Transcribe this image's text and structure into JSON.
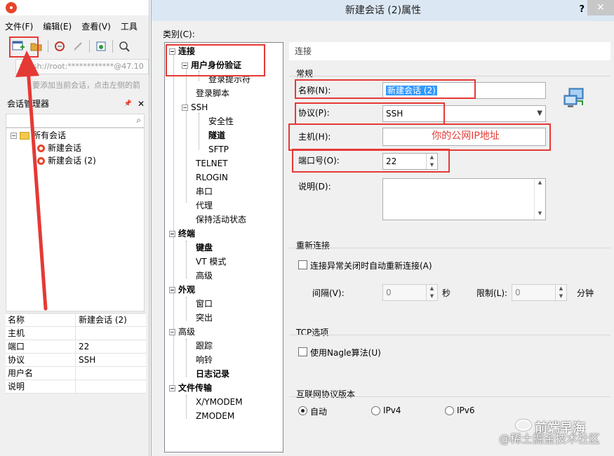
{
  "left": {
    "menu": [
      "文件(F)",
      "编辑(E)",
      "查看(V)",
      "工具"
    ],
    "address": "ssh://root:************@47.10",
    "hint": "要添加当前会话，点击左侧的箭",
    "session_manager_title": "会话管理器",
    "pin_glyph": "📌",
    "close_glyph": "✕",
    "tree": {
      "root": "所有会话",
      "items": [
        "新建会话",
        "新建会话 (2)"
      ]
    },
    "properties": [
      {
        "key": "名称",
        "value": "新建会话 (2)"
      },
      {
        "key": "主机",
        "value": ""
      },
      {
        "key": "端口",
        "value": "22"
      },
      {
        "key": "协议",
        "value": "SSH"
      },
      {
        "key": "用户名",
        "value": ""
      },
      {
        "key": "说明",
        "value": ""
      }
    ]
  },
  "dialog": {
    "title": "新建会话 (2)属性",
    "help": "?",
    "close": "✕",
    "category_label": "类别(C):",
    "categories": {
      "connection": "连接",
      "auth": "用户身份验证",
      "login_prompt": "登录提示符",
      "login_script": "登录脚本",
      "ssh": "SSH",
      "security": "安全性",
      "tunnel": "隧道",
      "sftp": "SFTP",
      "telnet": "TELNET",
      "rlogin": "RLOGIN",
      "serial": "串口",
      "proxy": "代理",
      "keepalive": "保持活动状态",
      "terminal": "终端",
      "keyboard": "键盘",
      "vt_mode": "VT 模式",
      "advanced_term": "高级",
      "appearance": "外观",
      "window": "窗口",
      "highlight": "突出",
      "advanced": "高级",
      "trace": "跟踪",
      "bell": "响铃",
      "logging": "日志记录",
      "file_transfer": "文件传输",
      "xymodem": "X/YMODEM",
      "zmodem": "ZMODEM"
    },
    "section_header": "连接",
    "general": {
      "title": "常规",
      "name_label": "名称(N):",
      "name_value": "新建会话 (2)",
      "protocol_label": "协议(P):",
      "protocol_value": "SSH",
      "host_label": "主机(H):",
      "host_annotation": "你的公网IP地址",
      "port_label": "端口号(O):",
      "port_value": "22",
      "desc_label": "说明(D):"
    },
    "reconnect": {
      "title": "重新连接",
      "checkbox_label": "连接异常关闭时自动重新连接(A)",
      "interval_label": "间隔(V):",
      "interval_value": "0",
      "seconds": "秒",
      "limit_label": "限制(L):",
      "limit_value": "0",
      "minutes": "分钟"
    },
    "tcp": {
      "title": "TCP选项",
      "nagle_label": "使用Nagle算法(U)"
    },
    "ip_version": {
      "title": "互联网协议版本",
      "auto": "自动",
      "ipv4": "IPv4",
      "ipv6": "IPv6",
      "selected": "auto"
    }
  },
  "watermark": {
    "line1": "前端早海",
    "line2": "@稀土掘金技术社区"
  },
  "colors": {
    "annotation_red": "#e53935",
    "title_bar": "#dbe8f4",
    "selection": "#3399ff"
  }
}
